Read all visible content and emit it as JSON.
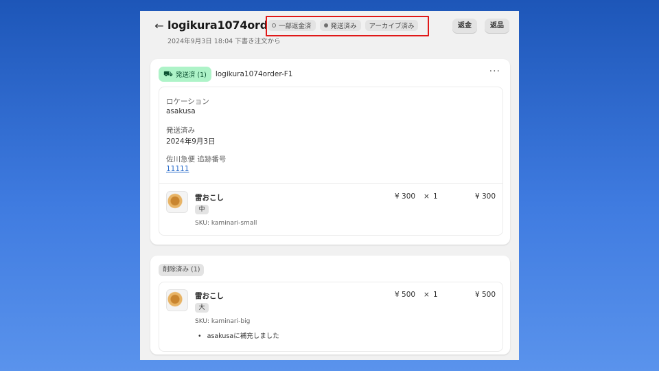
{
  "header": {
    "back_icon": "arrow-left-icon",
    "title": "logikura1074order",
    "subtitle": "2024年9月3日 18:04 下書き注文から",
    "badges": [
      {
        "label": "一部返金済",
        "icon": "partial-circle-icon"
      },
      {
        "label": "発送済み",
        "icon": "filled-circle-icon"
      },
      {
        "label": "アーカイブ済み"
      }
    ],
    "buttons": {
      "refund": "返金",
      "return": "返品"
    }
  },
  "fulfillment": {
    "status": "発送済 (1)",
    "status_icon": "truck-icon",
    "name": "logikura1074order-F1",
    "more_icon": "more-horizontal-icon",
    "location_label": "ロケーション",
    "location": "asakusa",
    "shipped_label": "発送済み",
    "shipped_date": "2024年9月3日",
    "tracking_label": "佐川急便 追跡番号",
    "tracking_number": "11111",
    "item": {
      "name": "雷おこし",
      "variant": "中",
      "sku": "SKU: kaminari-small",
      "price": "¥ 300",
      "times": "×",
      "qty": "1",
      "total": "¥ 300"
    }
  },
  "removed": {
    "status": "削除済み (1)",
    "item": {
      "name": "雷おこし",
      "variant": "大",
      "sku": "SKU: kaminari-big",
      "price": "¥ 500",
      "times": "×",
      "qty": "1",
      "total": "¥ 500",
      "note": "asakusaに補充しました"
    }
  },
  "colors": {
    "highlight": "#e01818",
    "fulfilled_badge": "#aef3c8",
    "background": "#2f6cd0"
  }
}
